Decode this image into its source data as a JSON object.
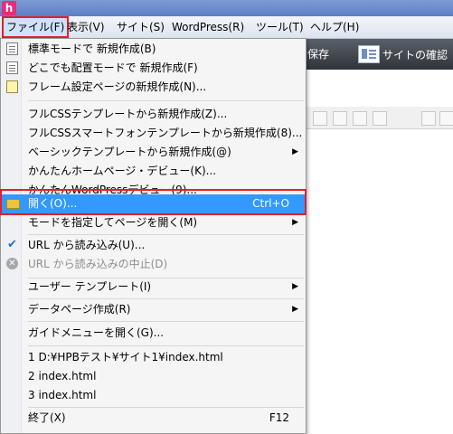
{
  "app": {
    "logo_letter": "h"
  },
  "menubar": [
    {
      "name": "menu-file",
      "label": "ファイル(F)",
      "active": true
    },
    {
      "name": "menu-view",
      "label": "表示(V)"
    },
    {
      "name": "menu-site",
      "label": "サイト(S)"
    },
    {
      "name": "menu-wordpress",
      "label": "WordPress(R)"
    },
    {
      "name": "menu-tools",
      "label": "ツール(T)"
    },
    {
      "name": "menu-help",
      "label": "ヘルプ(H)"
    }
  ],
  "toolbar": {
    "save_label": "保存",
    "confirm_label": "サイトの確認"
  },
  "file_menu": [
    {
      "id": "new-standard",
      "label": "標準モードで 新規作成(B)",
      "icon": "document-icon"
    },
    {
      "id": "new-anywhere",
      "label": "どこでも配置モードで 新規作成(F)",
      "icon": "document-icon"
    },
    {
      "id": "new-frame",
      "label": "フレーム設定ページの新規作成(N)...",
      "icon": "frame-page-icon"
    },
    {
      "id": "css-template",
      "label": "フルCSSテンプレートから新規作成(Z)..."
    },
    {
      "id": "css-smartphone",
      "label": "フルCSSスマートフォンテンプレートから新規作成(8)..."
    },
    {
      "id": "basic-template",
      "label": "ベーシックテンプレートから新規作成(@)",
      "submenu": true
    },
    {
      "id": "easy-homepage",
      "label": "かんたんホームページ・デビュー(K)..."
    },
    {
      "id": "easy-wordpress",
      "label": "かんたんWordPressデビュー(9)..."
    },
    {
      "id": "open",
      "label": "開く(O)...",
      "shortcut": "Ctrl+O",
      "icon": "open-folder-icon",
      "highlighted": true
    },
    {
      "id": "open-mode",
      "label": "モードを指定してページを開く(M)",
      "submenu": true
    },
    {
      "id": "url-load",
      "label": "URL から読み込み(U)...",
      "icon": "url-load-icon"
    },
    {
      "id": "url-stop",
      "label": "URL から読み込みの中止(D)",
      "icon": "stop-icon",
      "disabled": true
    },
    {
      "id": "user-template",
      "label": "ユーザー テンプレート(I)",
      "submenu": true
    },
    {
      "id": "data-page",
      "label": "データページ作成(R)",
      "submenu": true
    },
    {
      "id": "guide-menu",
      "label": "ガイドメニューを開く(G)..."
    },
    {
      "id": "recent-1",
      "label": "1 D:¥HPBテスト¥サイト1¥index.html"
    },
    {
      "id": "recent-2",
      "label": "2 index.html"
    },
    {
      "id": "recent-3",
      "label": "3 index.html"
    },
    {
      "id": "exit",
      "label": "終了(X)",
      "shortcut": "F12"
    }
  ]
}
